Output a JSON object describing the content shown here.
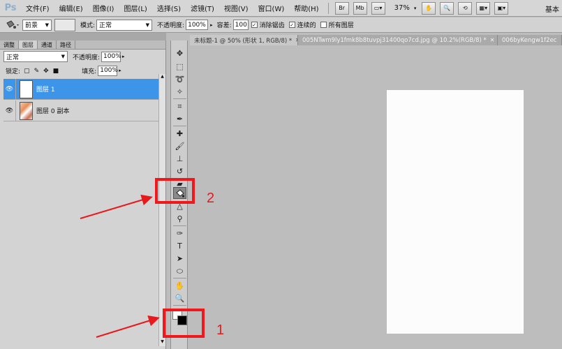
{
  "app": {
    "logo": "Ps",
    "workspace": "基本"
  },
  "menu": {
    "items": [
      "文件(F)",
      "编辑(E)",
      "图像(I)",
      "图层(L)",
      "选择(S)",
      "滤镜(T)",
      "视图(V)",
      "窗口(W)",
      "帮助(H)"
    ],
    "btn_br": "Br",
    "btn_mb": "Mb",
    "zoom": "37%"
  },
  "options": {
    "source_value": "前景",
    "mode_label": "模式:",
    "mode_value": "正常",
    "opacity_label": "不透明度:",
    "opacity_value": "100%",
    "tolerance_label": "容差:",
    "tolerance_value": "100",
    "antialias_label": "消除锯齿",
    "contiguous_label": "连续的",
    "all_layers_label": "所有图层"
  },
  "layers_panel": {
    "tabs": [
      "调整",
      "图层",
      "通道",
      "路径"
    ],
    "blend_mode": "正常",
    "opacity_label": "不透明度:",
    "opacity_value": "100%",
    "lock_label": "锁定:",
    "fill_label": "填充:",
    "fill_value": "100%",
    "layers": [
      {
        "name": "图层 1",
        "selected": true
      },
      {
        "name": "图层 0 副本",
        "selected": false
      }
    ]
  },
  "doc_tabs": [
    {
      "title": "未标题-1 @ 50% (形状 1, RGB/8) *",
      "active": true
    },
    {
      "title": "005NTwm9ly1fmk8b8tuvpj31400qo7cd.jpg @ 10.2%(RGB/8) *",
      "active": false
    },
    {
      "title": "006byKengw1f2ec",
      "active": false
    }
  ],
  "annotations": {
    "label_1": "1",
    "label_2": "2",
    "color": "#e8191d"
  },
  "colors": {
    "selection": "#3d95ea",
    "canvas": "#fcfcfd",
    "workspace_bg": "#bdbdbd"
  }
}
